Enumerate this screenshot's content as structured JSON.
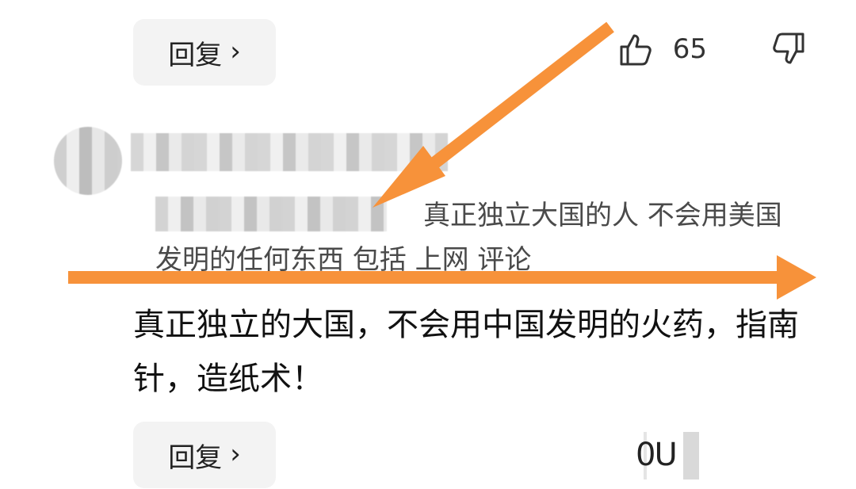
{
  "top": {
    "reply_label": "回复",
    "chevron": "›",
    "like_count": "65",
    "like_icon": "thumbs-up-icon",
    "dislike_icon": "thumbs-down-icon"
  },
  "quote": {
    "text": "真正独立大国的人 不会用美国发明的任何东西 包括 上网 评论"
  },
  "comment": {
    "text": "真正独立的大国，不会用中国发明的火药，指南针，造纸术！"
  },
  "bottom": {
    "reply_label": "回复",
    "chevron": "›",
    "partial_count": "0U"
  },
  "annotation": {
    "arrow_color": "#F7923A"
  }
}
